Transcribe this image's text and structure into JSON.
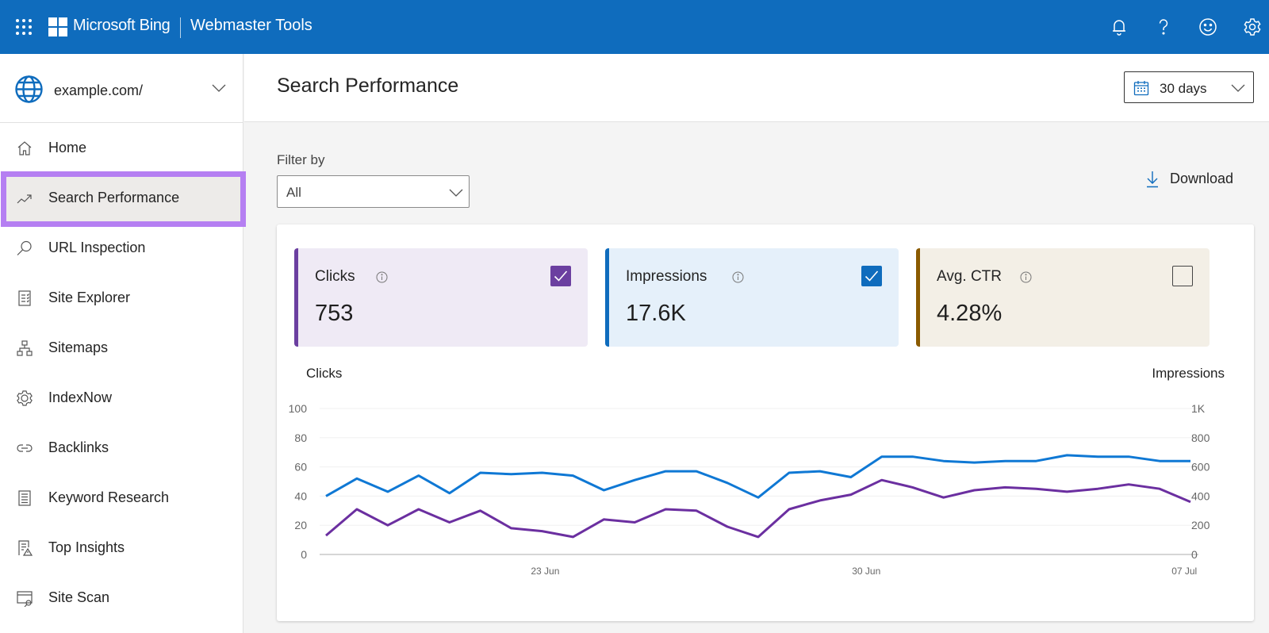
{
  "topbar": {
    "brand": "Microsoft Bing",
    "product": "Webmaster Tools",
    "icons": [
      "app-launcher-icon",
      "bell-icon",
      "help-icon",
      "feedback-smiley-icon",
      "settings-gear-icon"
    ],
    "brand_color": "#0f6cbd"
  },
  "sidebar": {
    "site": "example.com/",
    "items": [
      {
        "label": "Home",
        "icon": "home-icon",
        "active": false
      },
      {
        "label": "Search Performance",
        "icon": "trending-up-icon",
        "active": true
      },
      {
        "label": "URL Inspection",
        "icon": "search-icon",
        "active": false
      },
      {
        "label": "Site Explorer",
        "icon": "checklist-icon",
        "active": false
      },
      {
        "label": "Sitemaps",
        "icon": "sitemap-icon",
        "active": false
      },
      {
        "label": "IndexNow",
        "icon": "indexnow-gear-icon",
        "active": false
      },
      {
        "label": "Backlinks",
        "icon": "link-icon",
        "active": false
      },
      {
        "label": "Keyword Research",
        "icon": "document-list-icon",
        "active": false
      },
      {
        "label": "Top Insights",
        "icon": "insights-warning-icon",
        "active": false
      },
      {
        "label": "Site Scan",
        "icon": "site-scan-icon",
        "active": false
      }
    ],
    "highlight_color": "#b57ff2"
  },
  "header": {
    "title": "Search Performance",
    "date_range": "30 days"
  },
  "filter": {
    "label": "Filter by",
    "value": "All",
    "download_label": "Download"
  },
  "metrics": [
    {
      "label": "Clicks",
      "value": "753",
      "checked": true,
      "accent": "#6b3fa0",
      "bg": "#efeaf5"
    },
    {
      "label": "Impressions",
      "value": "17.6K",
      "checked": true,
      "accent": "#0f6cbd",
      "bg": "#e5f0fa"
    },
    {
      "label": "Avg. CTR",
      "value": "4.28%",
      "checked": false,
      "accent": "#8a5a00",
      "bg": "#f3efe6"
    }
  ],
  "chart_data": {
    "type": "line",
    "left_axis_title": "Clicks",
    "right_axis_title": "Impressions",
    "left_ylim": [
      0,
      100
    ],
    "right_ylim": [
      0,
      1000
    ],
    "left_ticks": [
      "0",
      "20",
      "40",
      "60",
      "80",
      "100"
    ],
    "right_ticks": [
      "0",
      "200",
      "400",
      "600",
      "800",
      "1K"
    ],
    "x_tick_labels": [
      {
        "label": "23 Jun",
        "index": 7.1
      },
      {
        "label": "30 Jun",
        "index": 17.5
      },
      {
        "label": "07 Jul",
        "index": 27.8
      }
    ],
    "grid": true,
    "series": [
      {
        "name": "Impressions",
        "axis": "right",
        "color": "#0f78d4",
        "values": [
          400,
          520,
          430,
          540,
          420,
          560,
          550,
          560,
          540,
          440,
          510,
          570,
          570,
          490,
          390,
          560,
          570,
          530,
          670,
          670,
          640,
          630,
          640,
          640,
          680,
          670,
          670,
          640,
          640
        ]
      },
      {
        "name": "Clicks",
        "axis": "left",
        "color": "#6b2fa0",
        "values": [
          13,
          31,
          20,
          31,
          22,
          30,
          18,
          16,
          12,
          24,
          22,
          31,
          30,
          19,
          12,
          31,
          37,
          41,
          51,
          46,
          39,
          44,
          46,
          45,
          43,
          45,
          48,
          45,
          36
        ]
      }
    ]
  }
}
